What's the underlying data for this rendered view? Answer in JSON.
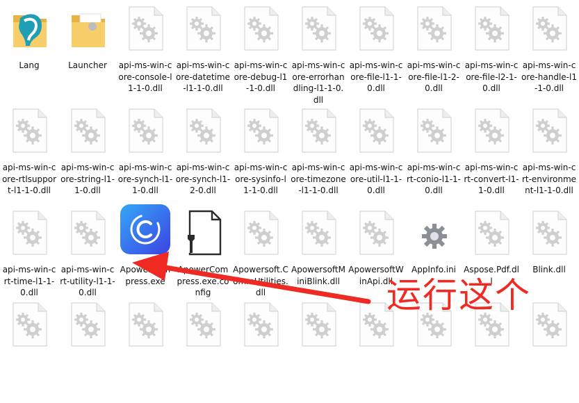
{
  "files": [
    {
      "name": "Lang",
      "icon": "folder-lang"
    },
    {
      "name": "Launcher",
      "icon": "folder"
    },
    {
      "name": "api-ms-win-core-console-l1-1-0.dll",
      "icon": "dll"
    },
    {
      "name": "api-ms-win-core-datetime-l1-1-0.dll",
      "icon": "dll"
    },
    {
      "name": "api-ms-win-core-debug-l1-1-0.dll",
      "icon": "dll"
    },
    {
      "name": "api-ms-win-core-errorhandling-l1-1-0.dll",
      "icon": "dll"
    },
    {
      "name": "api-ms-win-core-file-l1-1-0.dll",
      "icon": "dll"
    },
    {
      "name": "api-ms-win-core-file-l1-2-0.dll",
      "icon": "dll"
    },
    {
      "name": "api-ms-win-core-file-l2-1-0.dll",
      "icon": "dll"
    },
    {
      "name": "api-ms-win-core-handle-l1-1-0.dll",
      "icon": "dll"
    },
    {
      "name": "api-ms-win-core-rtlsupport-l1-1-0.dll",
      "icon": "dll"
    },
    {
      "name": "api-ms-win-core-string-l1-1-0.dll",
      "icon": "dll"
    },
    {
      "name": "api-ms-win-core-synch-l1-1-0.dll",
      "icon": "dll"
    },
    {
      "name": "api-ms-win-core-synch-l1-2-0.dll",
      "icon": "dll"
    },
    {
      "name": "api-ms-win-core-sysinfo-l1-1-0.dll",
      "icon": "dll"
    },
    {
      "name": "api-ms-win-core-timezone-l1-1-0.dll",
      "icon": "dll"
    },
    {
      "name": "api-ms-win-core-util-l1-1-0.dll",
      "icon": "dll"
    },
    {
      "name": "api-ms-win-crt-conio-l1-1-0.dll",
      "icon": "dll"
    },
    {
      "name": "api-ms-win-crt-convert-l1-1-0.dll",
      "icon": "dll"
    },
    {
      "name": "api-ms-win-crt-environment-l1-1-0.dll",
      "icon": "dll"
    },
    {
      "name": "api-ms-win-crt-time-l1-1-0.dll",
      "icon": "dll"
    },
    {
      "name": "api-ms-win-crt-utility-l1-1-0.dll",
      "icon": "dll"
    },
    {
      "name": "ApowerCompress.exe",
      "icon": "apower-app"
    },
    {
      "name": "ApowerCompress.exe.config",
      "icon": "config"
    },
    {
      "name": "Apowersoft.CommUtilities.dll",
      "icon": "dll"
    },
    {
      "name": "ApowersoftMiniBlink.dll",
      "icon": "dll"
    },
    {
      "name": "ApowersoftWinApi.dll",
      "icon": "dll"
    },
    {
      "name": "AppInfo.ini",
      "icon": "ini-gear"
    },
    {
      "name": "Aspose.Pdf.dll",
      "icon": "dll"
    },
    {
      "name": "Blink.dll",
      "icon": "dll"
    },
    {
      "name": "",
      "icon": "dll"
    },
    {
      "name": "",
      "icon": "dll"
    },
    {
      "name": "",
      "icon": "dll"
    },
    {
      "name": "",
      "icon": "dll"
    },
    {
      "name": "",
      "icon": "dll"
    },
    {
      "name": "",
      "icon": "dll"
    },
    {
      "name": "",
      "icon": "dll"
    },
    {
      "name": "",
      "icon": "dll"
    },
    {
      "name": "",
      "icon": "dll"
    },
    {
      "name": "",
      "icon": "dll"
    }
  ],
  "annotation": {
    "text": "运行这个",
    "color": "#ef2a23"
  },
  "colors": {
    "folder": "#f4c55a",
    "app_gradient_top": "#3aa0f5",
    "app_gradient_bottom": "#3a49e6",
    "doc_gear": "#c9c9c9"
  }
}
